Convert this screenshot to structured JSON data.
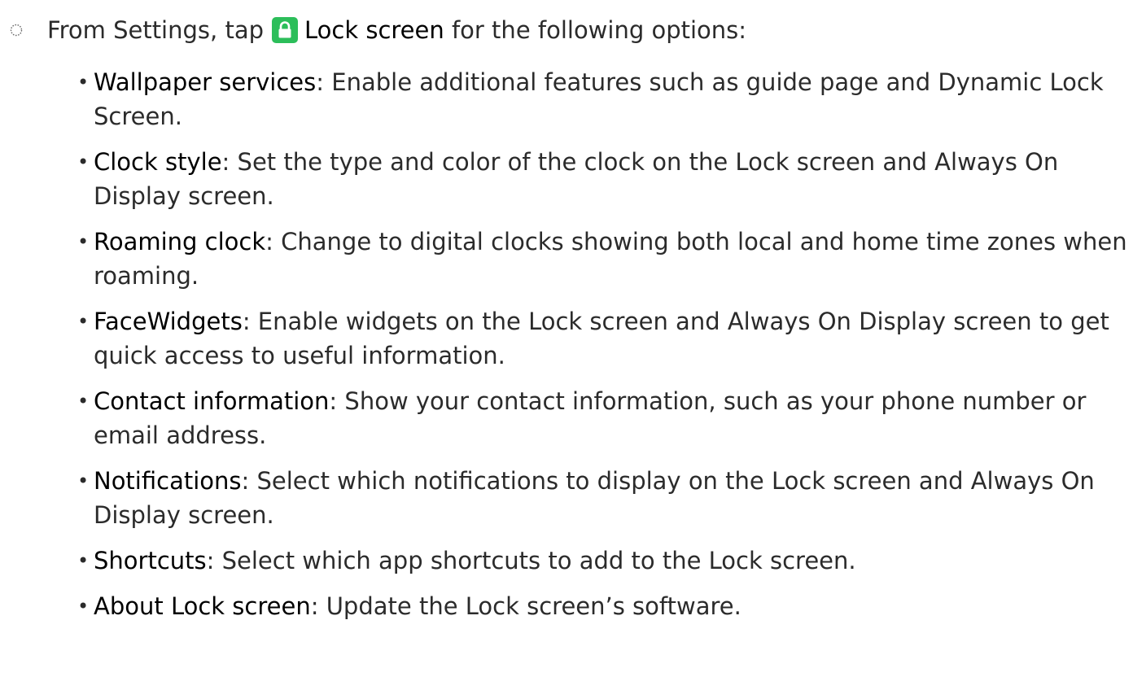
{
  "intro": {
    "prefix": "From Settings, tap",
    "target": "Lock screen",
    "suffix": "for the following options:",
    "icon": "lock-icon",
    "icon_color": "#2cbe5a"
  },
  "options": [
    {
      "term": "Wallpaper services",
      "desc": ": Enable additional features such as guide page and Dynamic Lock Screen."
    },
    {
      "term": "Clock style",
      "desc": ": Set the type and color of the clock on the Lock screen and Always On Display screen."
    },
    {
      "term": "Roaming clock",
      "desc": ": Change to digital clocks showing both local and home time zones when roaming."
    },
    {
      "term": "FaceWidgets",
      "desc": ": Enable widgets on the Lock screen and Always On Display screen to get quick access to useful information."
    },
    {
      "term": "Contact information",
      "desc": ": Show your contact information, such as your phone number or email address."
    },
    {
      "term": "Notifications",
      "desc": ": Select which notifications to display on the Lock screen and Always On Display screen."
    },
    {
      "term": "Shortcuts",
      "desc": ": Select which app shortcuts to add to the Lock screen."
    },
    {
      "term": "About Lock screen",
      "desc": ": Update the Lock screen’s software."
    }
  ]
}
